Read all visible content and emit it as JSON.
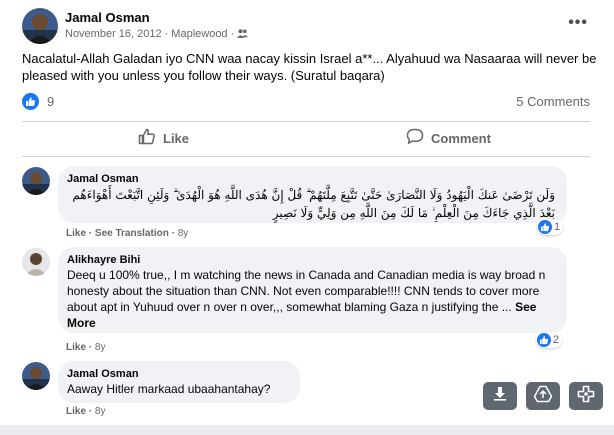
{
  "post": {
    "author": "Jamal Osman",
    "date": "November 16, 2012",
    "location": "Maplewood",
    "text": "Nacalatul-Allah Galadan iyo CNN waa nacay kissin Israel    a**... Alyahuud wa Nasaaraa will never be pleased with you unless you follow their ways. (Suratul baqara)",
    "reactions_count": "9",
    "comments_count": "5 Comments",
    "audience_icon": "friends-icon"
  },
  "actions": {
    "like_label": "Like",
    "comment_label": "Comment"
  },
  "comments": [
    {
      "author": "Jamal Osman",
      "text": "وَلَن تَرْضَىٰ عَنكَ الْيَهُودُ وَلَا النَّصَارَىٰ حَتَّىٰ تَتَّبِعَ مِلَّتَهُمْ ۗ قُلْ إِنَّ هُدَى اللَّهِ هُوَ الْهُدَىٰ ۗ وَلَئِنِ اتَّبَعْتَ أَهْوَاءَهُم بَعْدَ الَّذِي جَاءَكَ مِنَ الْعِلْمِ ۙ مَا لَكَ مِنَ اللَّهِ مِن وَلِيٍّ وَلَا نَصِيرٍ",
      "like_label": "Like",
      "translate_label": "See Translation",
      "age": "8y",
      "reaction_count": "1"
    },
    {
      "author": "Alikhayre Bihi",
      "text": "Deeq u 100% true,, I m watching the news in Canada and Canadian media is way broad n honesty about the situation than CNN. Not even comparable!!!! CNN tends to cover more about apt in Yuhuud over n over n over,,, somewhat blaming Gaza n justifying the ... ",
      "see_more": "See More",
      "like_label": "Like",
      "age": "8y",
      "reaction_count": "2"
    },
    {
      "author": "Jamal Osman",
      "text": "Aaway Hitler markaad ubaahantahay?",
      "like_label": "Like",
      "age": "8y"
    }
  ],
  "floating_tools": [
    "download-icon",
    "upload-icon",
    "puzzle-icon"
  ],
  "colors": {
    "brand_blue": "#1877f2",
    "bubble_gray": "#f0f2f5",
    "meta_gray": "#65676b",
    "tool_gray": "#606770"
  }
}
